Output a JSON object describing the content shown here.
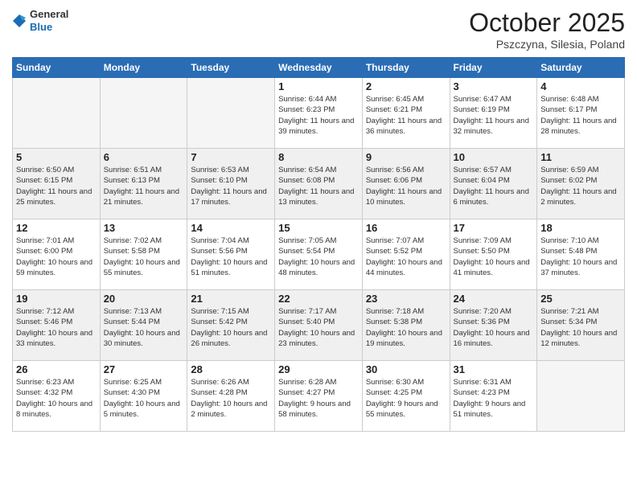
{
  "header": {
    "logo_general": "General",
    "logo_blue": "Blue",
    "month_title": "October 2025",
    "location": "Pszczyna, Silesia, Poland"
  },
  "weekdays": [
    "Sunday",
    "Monday",
    "Tuesday",
    "Wednesday",
    "Thursday",
    "Friday",
    "Saturday"
  ],
  "weeks": [
    {
      "shaded": false,
      "days": [
        {
          "day": "",
          "info": ""
        },
        {
          "day": "",
          "info": ""
        },
        {
          "day": "",
          "info": ""
        },
        {
          "day": "1",
          "info": "Sunrise: 6:44 AM\nSunset: 6:23 PM\nDaylight: 11 hours\nand 39 minutes."
        },
        {
          "day": "2",
          "info": "Sunrise: 6:45 AM\nSunset: 6:21 PM\nDaylight: 11 hours\nand 36 minutes."
        },
        {
          "day": "3",
          "info": "Sunrise: 6:47 AM\nSunset: 6:19 PM\nDaylight: 11 hours\nand 32 minutes."
        },
        {
          "day": "4",
          "info": "Sunrise: 6:48 AM\nSunset: 6:17 PM\nDaylight: 11 hours\nand 28 minutes."
        }
      ]
    },
    {
      "shaded": true,
      "days": [
        {
          "day": "5",
          "info": "Sunrise: 6:50 AM\nSunset: 6:15 PM\nDaylight: 11 hours\nand 25 minutes."
        },
        {
          "day": "6",
          "info": "Sunrise: 6:51 AM\nSunset: 6:13 PM\nDaylight: 11 hours\nand 21 minutes."
        },
        {
          "day": "7",
          "info": "Sunrise: 6:53 AM\nSunset: 6:10 PM\nDaylight: 11 hours\nand 17 minutes."
        },
        {
          "day": "8",
          "info": "Sunrise: 6:54 AM\nSunset: 6:08 PM\nDaylight: 11 hours\nand 13 minutes."
        },
        {
          "day": "9",
          "info": "Sunrise: 6:56 AM\nSunset: 6:06 PM\nDaylight: 11 hours\nand 10 minutes."
        },
        {
          "day": "10",
          "info": "Sunrise: 6:57 AM\nSunset: 6:04 PM\nDaylight: 11 hours\nand 6 minutes."
        },
        {
          "day": "11",
          "info": "Sunrise: 6:59 AM\nSunset: 6:02 PM\nDaylight: 11 hours\nand 2 minutes."
        }
      ]
    },
    {
      "shaded": false,
      "days": [
        {
          "day": "12",
          "info": "Sunrise: 7:01 AM\nSunset: 6:00 PM\nDaylight: 10 hours\nand 59 minutes."
        },
        {
          "day": "13",
          "info": "Sunrise: 7:02 AM\nSunset: 5:58 PM\nDaylight: 10 hours\nand 55 minutes."
        },
        {
          "day": "14",
          "info": "Sunrise: 7:04 AM\nSunset: 5:56 PM\nDaylight: 10 hours\nand 51 minutes."
        },
        {
          "day": "15",
          "info": "Sunrise: 7:05 AM\nSunset: 5:54 PM\nDaylight: 10 hours\nand 48 minutes."
        },
        {
          "day": "16",
          "info": "Sunrise: 7:07 AM\nSunset: 5:52 PM\nDaylight: 10 hours\nand 44 minutes."
        },
        {
          "day": "17",
          "info": "Sunrise: 7:09 AM\nSunset: 5:50 PM\nDaylight: 10 hours\nand 41 minutes."
        },
        {
          "day": "18",
          "info": "Sunrise: 7:10 AM\nSunset: 5:48 PM\nDaylight: 10 hours\nand 37 minutes."
        }
      ]
    },
    {
      "shaded": true,
      "days": [
        {
          "day": "19",
          "info": "Sunrise: 7:12 AM\nSunset: 5:46 PM\nDaylight: 10 hours\nand 33 minutes."
        },
        {
          "day": "20",
          "info": "Sunrise: 7:13 AM\nSunset: 5:44 PM\nDaylight: 10 hours\nand 30 minutes."
        },
        {
          "day": "21",
          "info": "Sunrise: 7:15 AM\nSunset: 5:42 PM\nDaylight: 10 hours\nand 26 minutes."
        },
        {
          "day": "22",
          "info": "Sunrise: 7:17 AM\nSunset: 5:40 PM\nDaylight: 10 hours\nand 23 minutes."
        },
        {
          "day": "23",
          "info": "Sunrise: 7:18 AM\nSunset: 5:38 PM\nDaylight: 10 hours\nand 19 minutes."
        },
        {
          "day": "24",
          "info": "Sunrise: 7:20 AM\nSunset: 5:36 PM\nDaylight: 10 hours\nand 16 minutes."
        },
        {
          "day": "25",
          "info": "Sunrise: 7:21 AM\nSunset: 5:34 PM\nDaylight: 10 hours\nand 12 minutes."
        }
      ]
    },
    {
      "shaded": false,
      "days": [
        {
          "day": "26",
          "info": "Sunrise: 6:23 AM\nSunset: 4:32 PM\nDaylight: 10 hours\nand 8 minutes."
        },
        {
          "day": "27",
          "info": "Sunrise: 6:25 AM\nSunset: 4:30 PM\nDaylight: 10 hours\nand 5 minutes."
        },
        {
          "day": "28",
          "info": "Sunrise: 6:26 AM\nSunset: 4:28 PM\nDaylight: 10 hours\nand 2 minutes."
        },
        {
          "day": "29",
          "info": "Sunrise: 6:28 AM\nSunset: 4:27 PM\nDaylight: 9 hours\nand 58 minutes."
        },
        {
          "day": "30",
          "info": "Sunrise: 6:30 AM\nSunset: 4:25 PM\nDaylight: 9 hours\nand 55 minutes."
        },
        {
          "day": "31",
          "info": "Sunrise: 6:31 AM\nSunset: 4:23 PM\nDaylight: 9 hours\nand 51 minutes."
        },
        {
          "day": "",
          "info": ""
        }
      ]
    }
  ]
}
